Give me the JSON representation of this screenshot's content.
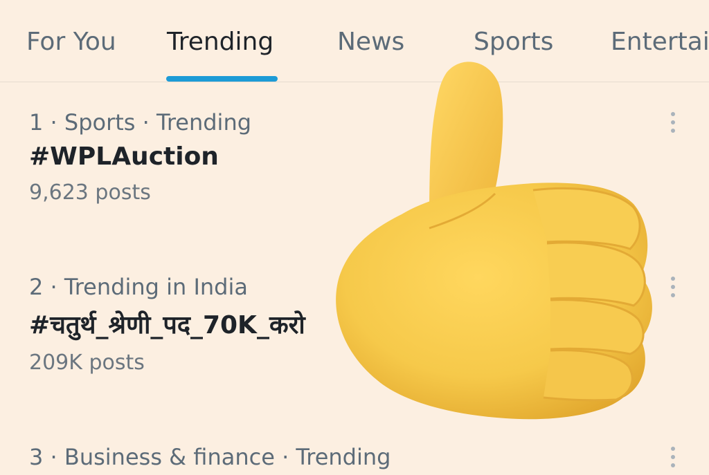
{
  "tabs": [
    {
      "label": "For You"
    },
    {
      "label": "Trending"
    },
    {
      "label": "News"
    },
    {
      "label": "Sports"
    },
    {
      "label": "Entertai"
    }
  ],
  "active_tab": "Trending",
  "trends": [
    {
      "meta": "1 · Sports · Trending",
      "title": "#WPLAuction",
      "count": "9,623 posts"
    },
    {
      "meta": "2 · Trending in India",
      "title": "#चतुर्थ_श्रेणी_पद_70K_करो",
      "count": "209K posts"
    },
    {
      "meta": "3 · Business & finance · Trending"
    }
  ],
  "overlay": {
    "icon": "thumbs-up-icon",
    "color": "#f6c94a"
  },
  "colors": {
    "background": "#fcefe1",
    "accent": "#1d9bd6",
    "text": "#1e2329",
    "muted": "#5c6b78"
  }
}
